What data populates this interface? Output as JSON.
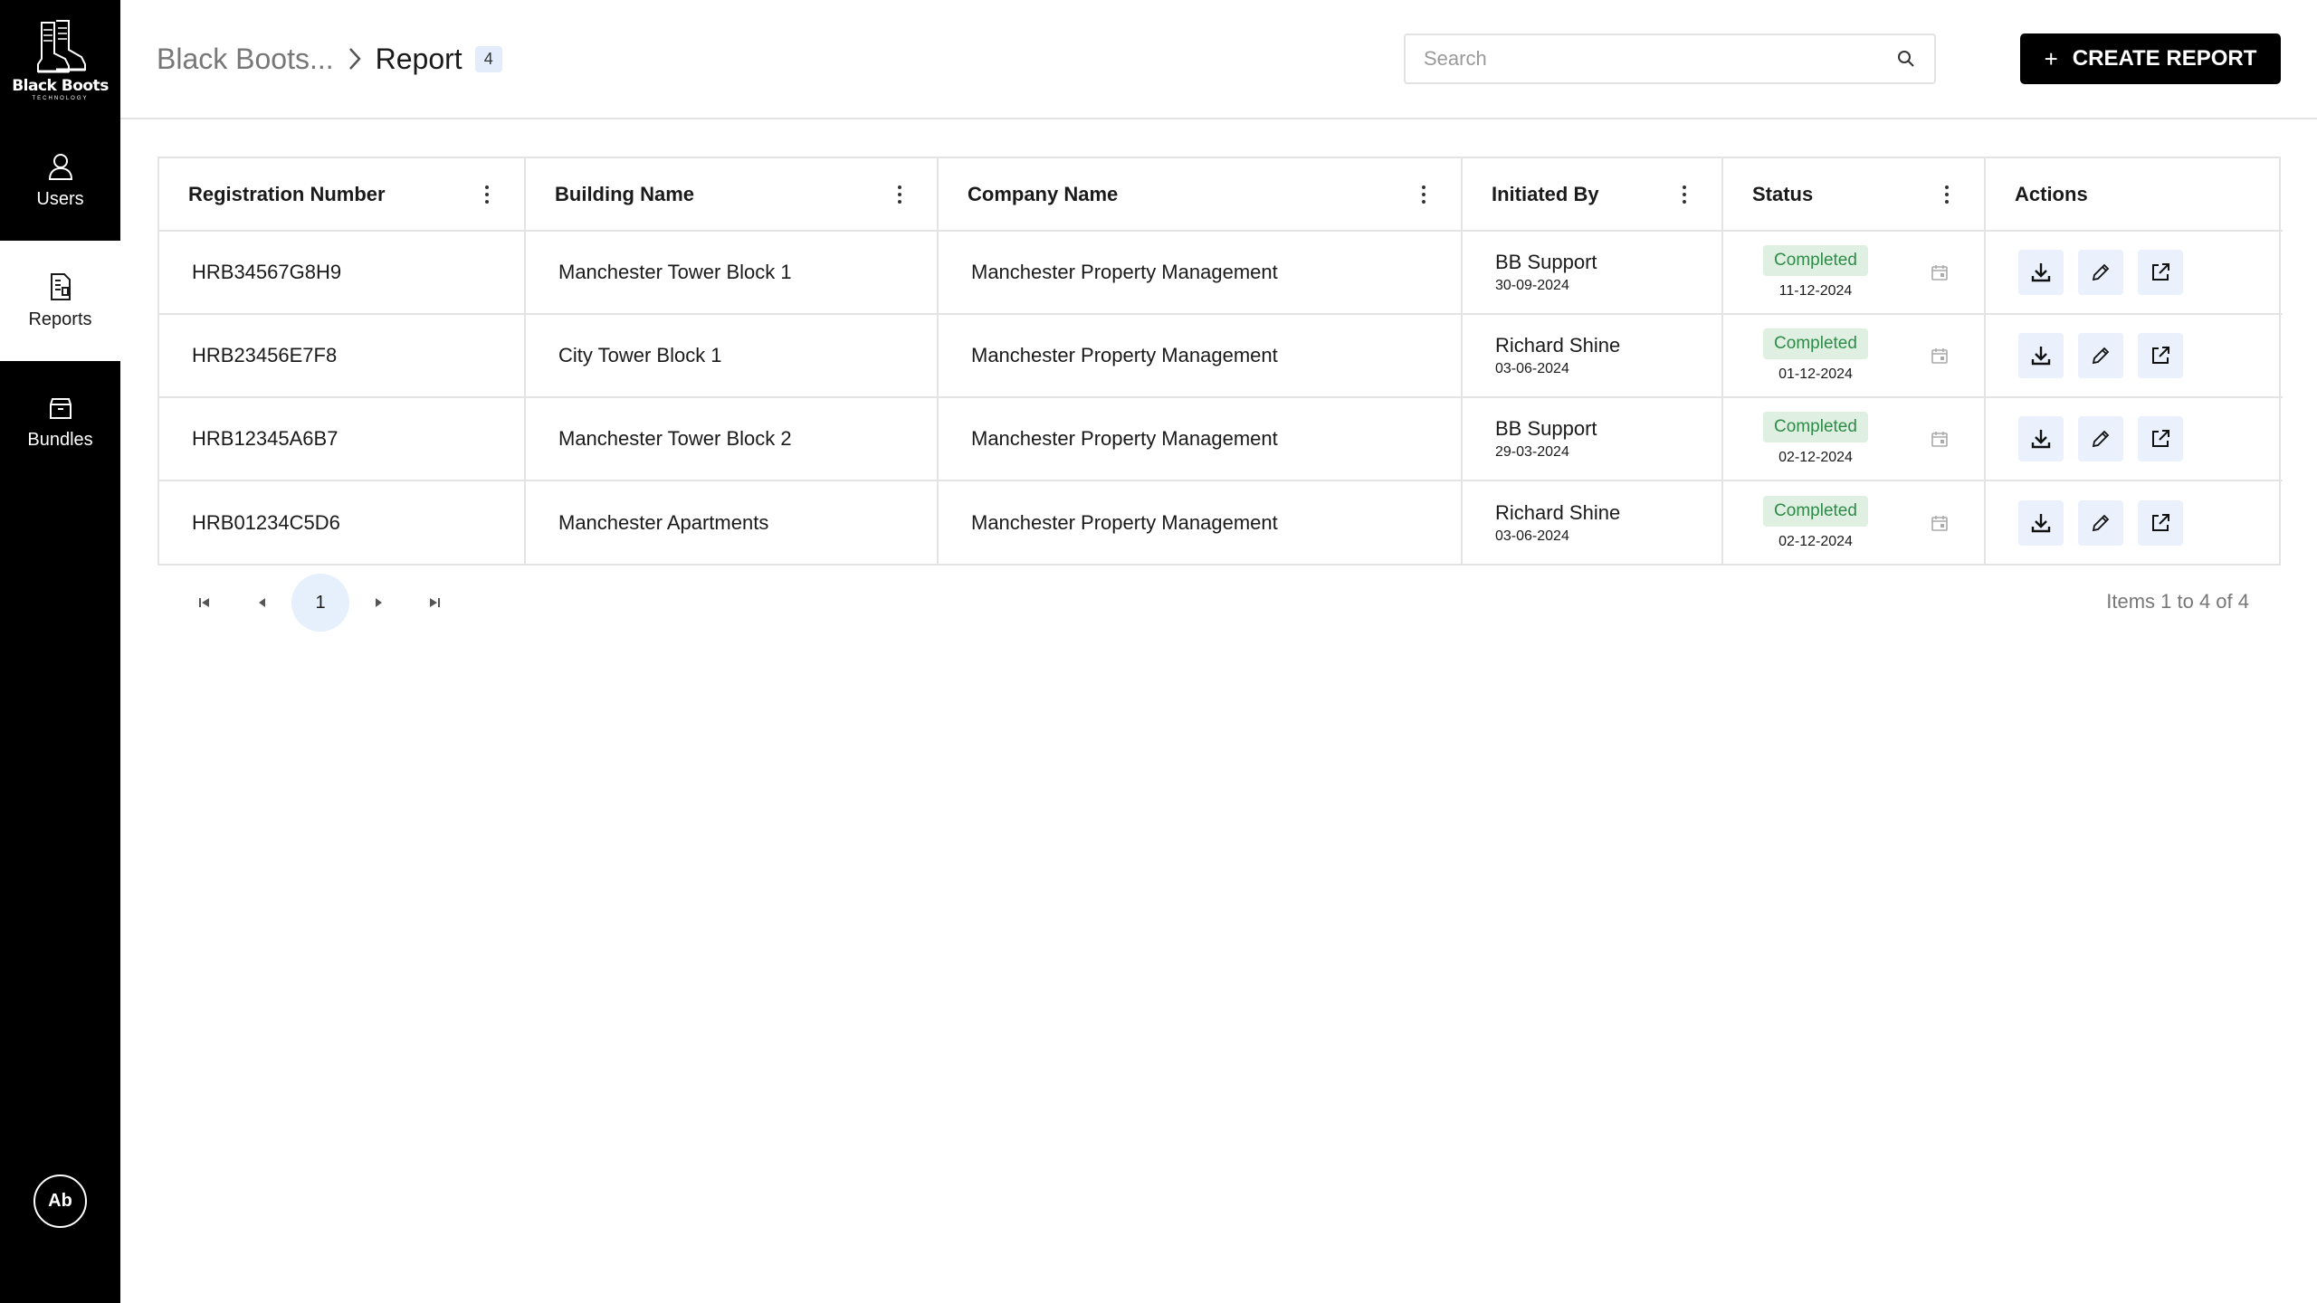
{
  "brand": {
    "name": "Black Boots",
    "sub": "TECHNOLOGY"
  },
  "nav": [
    {
      "label": "Users",
      "icon": "user-icon"
    },
    {
      "label": "Reports",
      "icon": "report-icon"
    },
    {
      "label": "Bundles",
      "icon": "bundle-icon"
    }
  ],
  "user": {
    "initials": "Ab"
  },
  "breadcrumb": {
    "parent": "Black Boots...",
    "current": "Report",
    "count": "4"
  },
  "search": {
    "placeholder": "Search",
    "value": ""
  },
  "create_button": {
    "label": "CREATE REPORT"
  },
  "table": {
    "columns": [
      "Registration Number",
      "Building Name",
      "Company Name",
      "Initiated By",
      "Status",
      "Actions"
    ],
    "rows": [
      {
        "registration": "HRB34567G8H9",
        "building": "Manchester Tower Block 1",
        "company": "Manchester Property Management",
        "initiator": "BB Support",
        "initiated_date": "30-09-2024",
        "status": "Completed",
        "status_date": "11-12-2024"
      },
      {
        "registration": "HRB23456E7F8",
        "building": "City Tower Block 1",
        "company": "Manchester Property Management",
        "initiator": "Richard Shine",
        "initiated_date": "03-06-2024",
        "status": "Completed",
        "status_date": "01-12-2024"
      },
      {
        "registration": "HRB12345A6B7",
        "building": "Manchester Tower Block 2",
        "company": "Manchester Property Management",
        "initiator": "BB Support",
        "initiated_date": "29-03-2024",
        "status": "Completed",
        "status_date": "02-12-2024"
      },
      {
        "registration": "HRB01234C5D6",
        "building": "Manchester Apartments",
        "company": "Manchester Property Management",
        "initiator": "Richard Shine",
        "initiated_date": "03-06-2024",
        "status": "Completed",
        "status_date": "02-12-2024"
      }
    ]
  },
  "pagination": {
    "current_page": "1",
    "info": "Items 1 to 4 of 4"
  },
  "colors": {
    "sidebar": "#000000",
    "badge_bg": "#dff0e3",
    "badge_text": "#2e8b47",
    "action_bg": "#eaf1fc",
    "page_bg": "#e6effc"
  }
}
